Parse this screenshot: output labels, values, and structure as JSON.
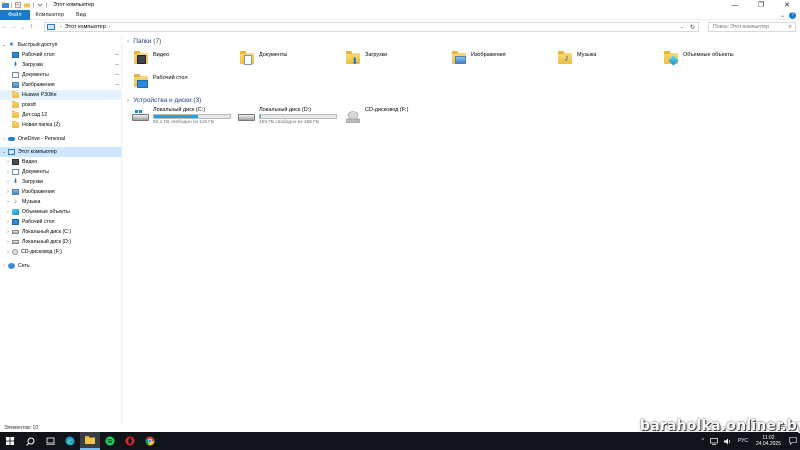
{
  "window": {
    "title": "Этот компьютер",
    "controls": [
      "—",
      "❐",
      "✕"
    ]
  },
  "ribbon": {
    "tabs": [
      "Файл",
      "Компьютер",
      "Вид"
    ],
    "expand_icon": "chevron-down-icon",
    "help_icon": "help-icon"
  },
  "address": {
    "path_label": "Этот компьютер",
    "chevron": "›",
    "search_placeholder": "Поиск: Этот компьютер"
  },
  "sidebar": {
    "quick_access": {
      "label": "Быстрый доступ",
      "items": [
        {
          "label": "Рабочий стол",
          "icon": "desktop-icon",
          "pinned": true
        },
        {
          "label": "Загрузки",
          "icon": "downloads-icon",
          "pinned": true
        },
        {
          "label": "Документы",
          "icon": "documents-icon",
          "pinned": true
        },
        {
          "label": "Изображения",
          "icon": "pictures-icon",
          "pinned": true
        },
        {
          "label": "Huawei P30lite",
          "icon": "folder-icon",
          "pinned": false
        },
        {
          "label": "posstt",
          "icon": "folder-icon",
          "pinned": false
        },
        {
          "label": "Дет.сад 12",
          "icon": "folder-icon",
          "pinned": false
        },
        {
          "label": "Новая папка (2)",
          "icon": "folder-icon",
          "pinned": false
        }
      ]
    },
    "onedrive": {
      "label": "OneDrive - Personal",
      "icon": "onedrive-icon"
    },
    "this_pc": {
      "label": "Этот компьютер",
      "items": [
        {
          "label": "Видео",
          "icon": "videos-icon"
        },
        {
          "label": "Документы",
          "icon": "documents-icon"
        },
        {
          "label": "Загрузки",
          "icon": "downloads-icon"
        },
        {
          "label": "Изображения",
          "icon": "pictures-icon"
        },
        {
          "label": "Музыка",
          "icon": "music-icon"
        },
        {
          "label": "Объемные объекты",
          "icon": "3d-objects-icon"
        },
        {
          "label": "Рабочий стол",
          "icon": "desktop-icon"
        },
        {
          "label": "Локальный диск (C:)",
          "icon": "drive-icon"
        },
        {
          "label": "Локальный диск (D:)",
          "icon": "drive-icon"
        },
        {
          "label": "CD-дисковод (F:)",
          "icon": "cd-drive-icon"
        }
      ]
    },
    "network": {
      "label": "Сеть",
      "icon": "network-icon"
    }
  },
  "content": {
    "folders_header": "Папки (7)",
    "folders": [
      {
        "label": "Видео",
        "icon": "videos-icon"
      },
      {
        "label": "Документы",
        "icon": "documents-icon"
      },
      {
        "label": "Загрузки",
        "icon": "downloads-icon"
      },
      {
        "label": "Изображения",
        "icon": "pictures-icon"
      },
      {
        "label": "Музыка",
        "icon": "music-icon"
      },
      {
        "label": "Объемные объекты",
        "icon": "3d-objects-icon"
      },
      {
        "label": "Рабочий стол",
        "icon": "desktop-icon"
      }
    ],
    "devices_header": "Устройства и диски (3)",
    "devices": [
      {
        "label": "Локальный диск (C:)",
        "free": "50,1 ГБ свободно из 118 ГБ",
        "used_fraction": 0.58,
        "icon": "windows-drive-icon"
      },
      {
        "label": "Локальный диск (D:)",
        "free": "459 ГБ свободно из 465 ГБ",
        "used_fraction": 0.013,
        "icon": "drive-icon"
      },
      {
        "label": "CD-дисковод (F:)",
        "free": "",
        "icon": "cd-drive-icon"
      }
    ]
  },
  "status": {
    "items_count": "Элементов: 10"
  },
  "taskbar": {
    "apps": [
      "start-icon",
      "search-icon",
      "task-view-icon",
      "edge-icon",
      "file-explorer-icon",
      "spotify-icon",
      "opera-icon",
      "chrome-icon"
    ],
    "language": "РУС",
    "time": "11:02",
    "date": "24.04.2025"
  },
  "watermark": "baraholka.onliner.by",
  "colors": {
    "accent": "#1979ca",
    "selection": "#cce8ff",
    "drive_bar": "#26a0da",
    "group_header": "#1e3f82",
    "taskbar": "#101318"
  }
}
